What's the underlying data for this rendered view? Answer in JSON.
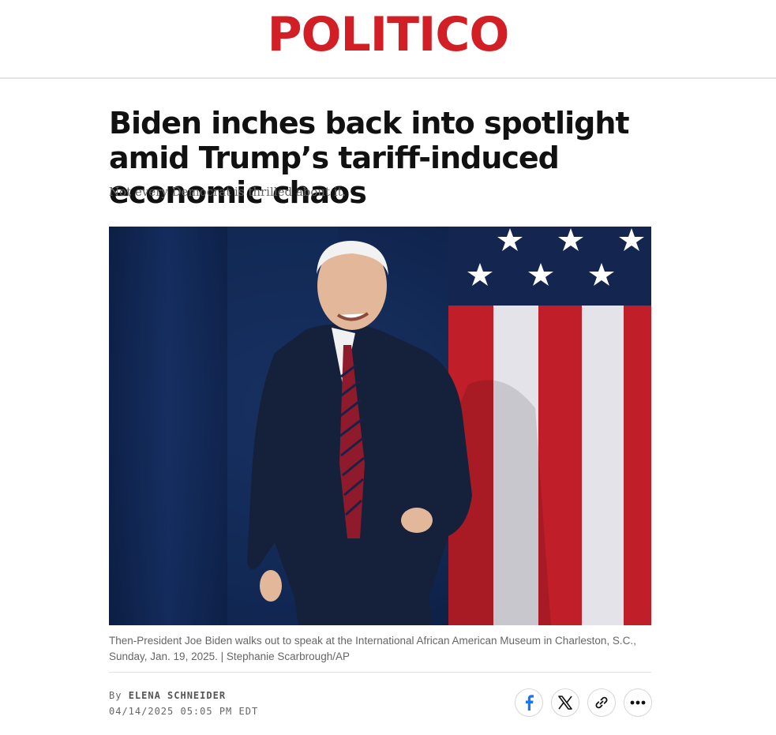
{
  "masthead": {
    "logo_text": "POLITICO"
  },
  "article": {
    "headline": "Biden inches back into spotlight amid Trump’s tariff-induced economic chaos",
    "dek": "Not every Democrat is thrilled about it.",
    "photo": {
      "subject": "Then-President Joe Biden walking on stage in front of an American flag"
    },
    "caption": "Then-President Joe Biden walks out to speak at the International African American Museum in Charleston, S.C., Sunday, Jan. 19, 2025. | Stephanie Scarbrough/AP",
    "byline": {
      "prefix": "By",
      "author": "ELENA SCHNEIDER"
    },
    "timestamp": "04/14/2025 05:05 PM EDT"
  },
  "share": [
    {
      "icon": "facebook-icon",
      "label": "Share on Facebook"
    },
    {
      "icon": "x-icon",
      "label": "Share on X"
    },
    {
      "icon": "link-icon",
      "label": "Copy link"
    },
    {
      "icon": "more-icon",
      "label": "More sharing options"
    }
  ],
  "colors": {
    "brand": "#d21f26",
    "flag_red": "#bf1f2a",
    "flag_white": "#e4e3ea",
    "navy": "#0d1f44",
    "facebook": "#1877f2"
  }
}
